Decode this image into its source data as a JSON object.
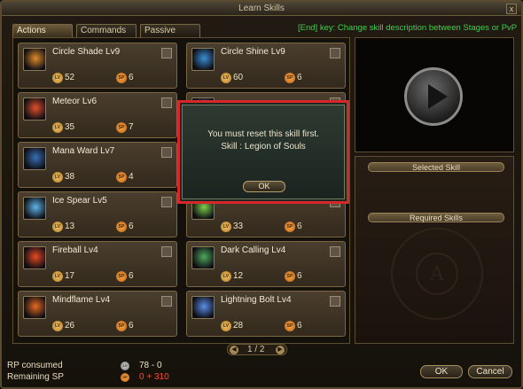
{
  "window": {
    "title": "Learn Skills",
    "close_label": "x"
  },
  "tabs": [
    {
      "label": "Actions",
      "active": true
    },
    {
      "label": "Commands",
      "active": false
    },
    {
      "label": "Passive",
      "active": false
    }
  ],
  "hint": "[End] key: Change skill description between Stages or PvP",
  "coins": {
    "lv_label": "LV",
    "sp_label": "SP"
  },
  "skills": [
    {
      "name": "Circle Shade Lv9",
      "level": "52",
      "sp": "6",
      "icon": "circle-shade-icon",
      "color": "#e08a2a"
    },
    {
      "name": "Circle Shine Lv9",
      "level": "60",
      "sp": "6",
      "icon": "circle-shine-icon",
      "color": "#3a8fd6"
    },
    {
      "name": "Meteor Lv6",
      "level": "35",
      "sp": "7",
      "icon": "meteor-icon",
      "color": "#e0502a"
    },
    {
      "name": "",
      "level": "",
      "sp": "",
      "icon": "hidden-skill-icon",
      "color": "#4a6a8a"
    },
    {
      "name": "Mana Ward Lv7",
      "level": "38",
      "sp": "4",
      "icon": "mana-ward-icon",
      "color": "#3a6fb6"
    },
    {
      "name": "",
      "level": "",
      "sp": "",
      "icon": "hidden-skill-icon",
      "color": "#4a6a8a"
    },
    {
      "name": "Ice Spear Lv5",
      "level": "13",
      "sp": "6",
      "icon": "ice-spear-icon",
      "color": "#5fb4e8"
    },
    {
      "name": "Soul Shaker Lv5",
      "level": "33",
      "sp": "6",
      "icon": "soul-shaker-icon",
      "color": "#7ed04a"
    },
    {
      "name": "Fireball Lv4",
      "level": "17",
      "sp": "6",
      "icon": "fireball-icon",
      "color": "#e84a20"
    },
    {
      "name": "Dark Calling Lv4",
      "level": "12",
      "sp": "6",
      "icon": "dark-calling-icon",
      "color": "#4ea85a"
    },
    {
      "name": "Mindflame Lv4",
      "level": "26",
      "sp": "6",
      "icon": "mindflame-icon",
      "color": "#e86a20"
    },
    {
      "name": "Lightning Bolt Lv4",
      "level": "28",
      "sp": "6",
      "icon": "lightning-bolt-icon",
      "color": "#5a8ee8"
    }
  ],
  "pager": {
    "text": "1 / 2",
    "prev": "◀",
    "next": "▶"
  },
  "info": {
    "selected_skill": "Selected Skill",
    "required_skills": "Required Skills"
  },
  "emblem": {
    "letter": "A"
  },
  "bottom": {
    "rp_label": "RP consumed",
    "rp_value": "78 - 0",
    "sp_label": "Remaining SP",
    "sp_value": "0 + 310",
    "rp_color": "#efe3c0",
    "sp_color": "#ff4a2a"
  },
  "buttons": {
    "ok": "OK",
    "cancel": "Cancel"
  },
  "dialog": {
    "line1": "You must reset this skill first.",
    "line2": "Skill : Legion of Souls",
    "ok": "OK"
  }
}
